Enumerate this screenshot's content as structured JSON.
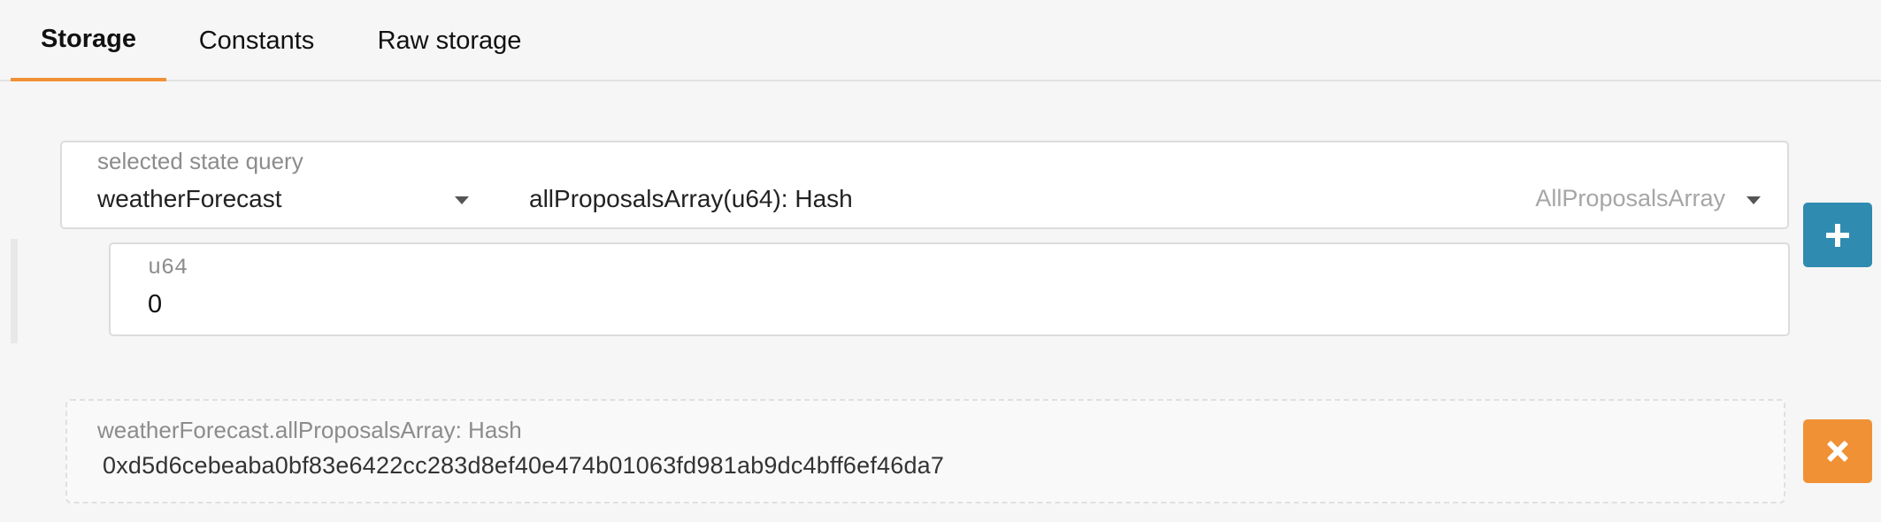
{
  "tabs": [
    {
      "label": "Storage",
      "active": true
    },
    {
      "label": "Constants",
      "active": false
    },
    {
      "label": "Raw storage",
      "active": false
    }
  ],
  "query": {
    "label": "selected state query",
    "module": "weatherForecast",
    "method": "allProposalsArray(u64): Hash",
    "method_hint": "AllProposalsArray"
  },
  "param": {
    "type_label": "u64",
    "value": "0"
  },
  "result": {
    "label": "weatherForecast.allProposalsArray: Hash",
    "value": "0xd5d6cebeaba0bf83e6422cc283d8ef40e474b01063fd981ab9dc4bff6ef46da7"
  },
  "icons": {
    "add": "plus-icon",
    "remove": "close-icon",
    "dropdown": "chevron-down-icon"
  },
  "colors": {
    "accent_orange": "#f19135",
    "add_blue": "#2f8bb0"
  }
}
